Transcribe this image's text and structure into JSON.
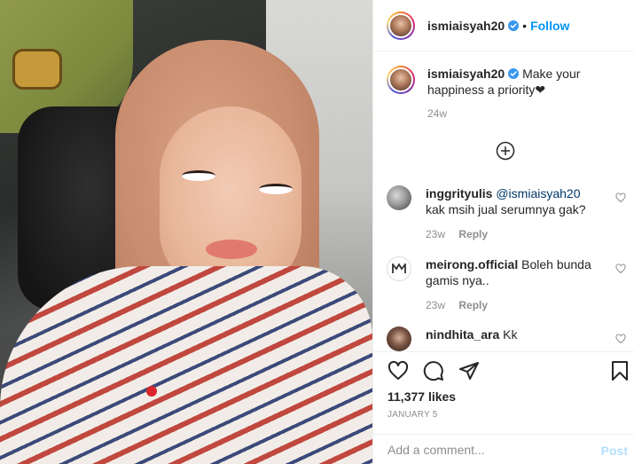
{
  "post": {
    "author": "ismiaisyah20",
    "follow_label": "Follow",
    "separator": "•",
    "caption": "Make your happiness a priority❤",
    "caption_time": "24w",
    "load_more_icon": "plus-circle-icon"
  },
  "comments": [
    {
      "user": "inggrityulis",
      "mention": "@ismiaisyah20",
      "text": "kak msih jual serumnya gak?",
      "time": "23w",
      "reply_label": "Reply"
    },
    {
      "user": "meirong.official",
      "text": "Boleh bunda gamis nya..",
      "time": "23w",
      "reply_label": "Reply"
    },
    {
      "user": "nindhita_ara",
      "text": "Kk"
    }
  ],
  "actions": {
    "likes": "11,377 likes",
    "date": "JANUARY 5",
    "icons": [
      "heart-icon",
      "comment-icon",
      "share-icon",
      "bookmark-icon"
    ]
  },
  "add_comment": {
    "placeholder": "Add a comment...",
    "post_label": "Post"
  },
  "colors": {
    "accent": "#0095f6",
    "post_disabled": "#b2dffc",
    "muted": "#8e8e8e",
    "text": "#262626"
  }
}
